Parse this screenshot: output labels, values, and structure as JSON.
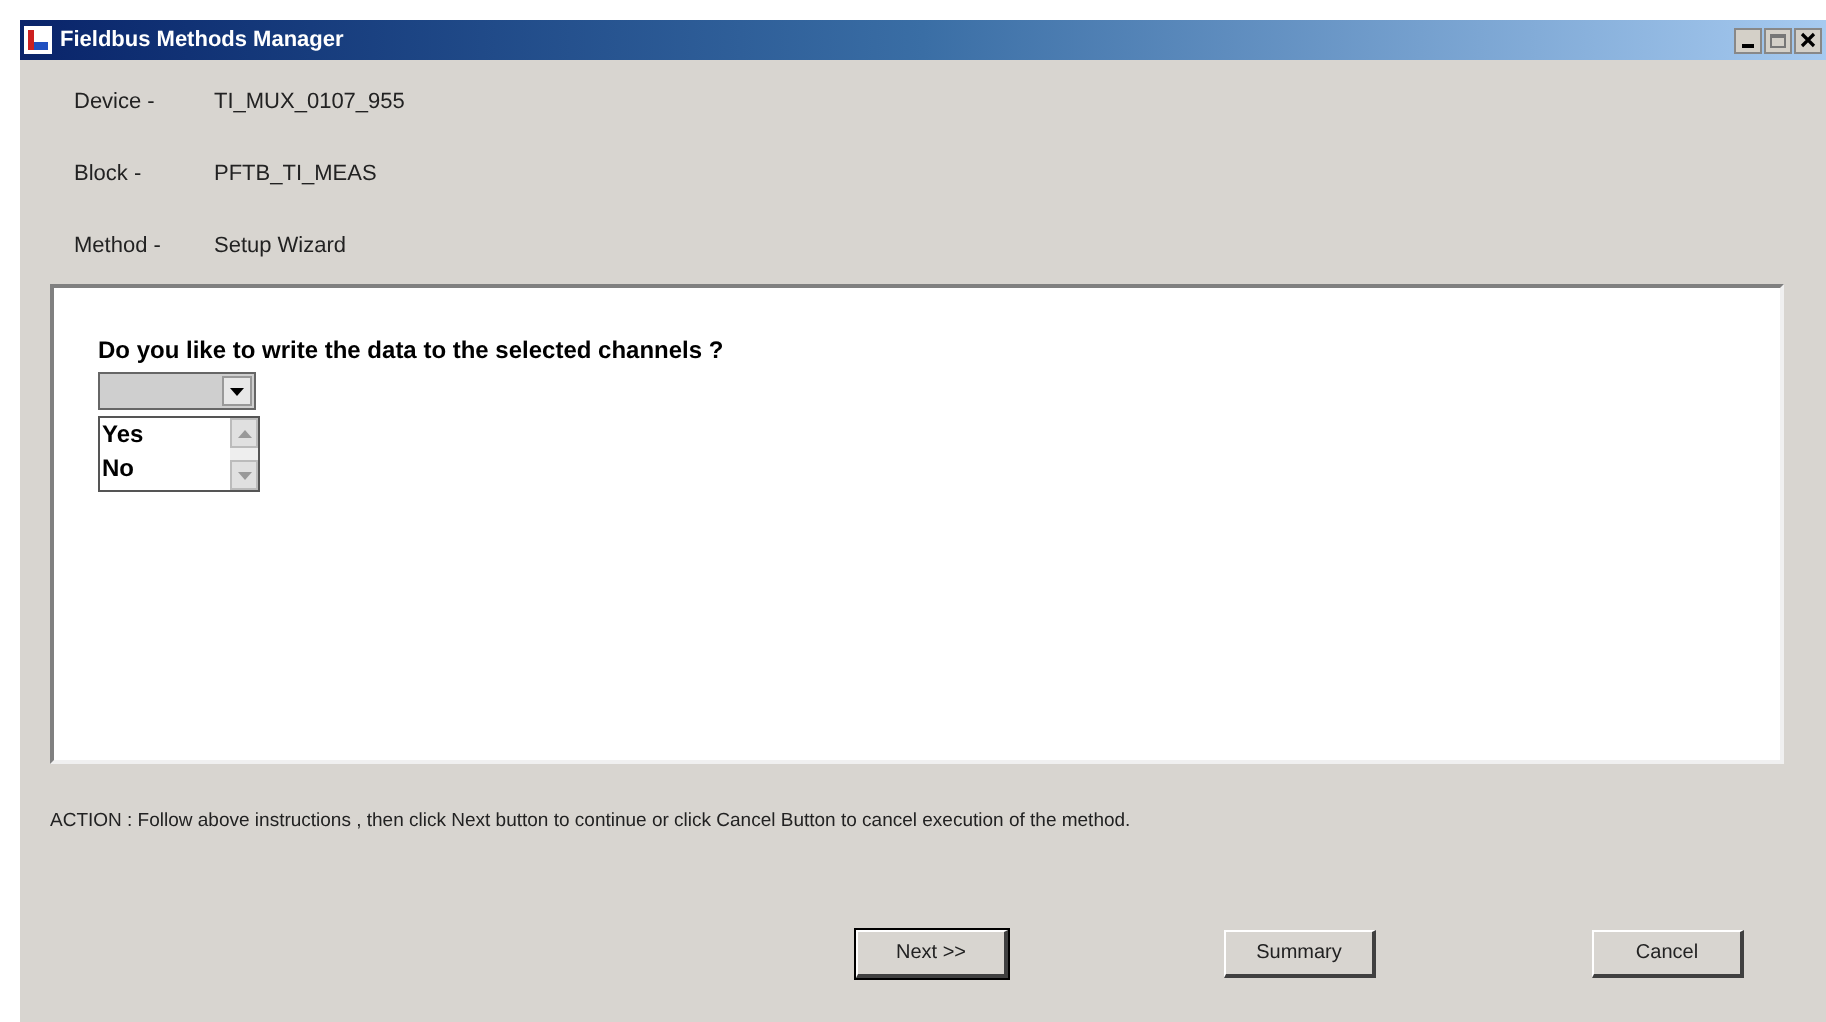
{
  "window": {
    "title": "Fieldbus Methods Manager"
  },
  "info": [
    {
      "label": "Device -",
      "value": "TI_MUX_0107_955"
    },
    {
      "label": "Block -",
      "value": "PFTB_TI_MEAS"
    },
    {
      "label": "Method -",
      "value": "Setup Wizard"
    }
  ],
  "question": "Do you like to write the data to the selected channels ?",
  "options": [
    {
      "label": "Yes",
      "selected": false
    },
    {
      "label": "No",
      "selected": false
    }
  ],
  "action": "ACTION : Follow above instructions , then click Next button to continue or click Cancel Button to cancel execution of the method.",
  "buttons": [
    {
      "label": "Next >>",
      "default": true
    },
    {
      "label": "Summary",
      "default": false
    },
    {
      "label": "Cancel",
      "default": false
    }
  ]
}
